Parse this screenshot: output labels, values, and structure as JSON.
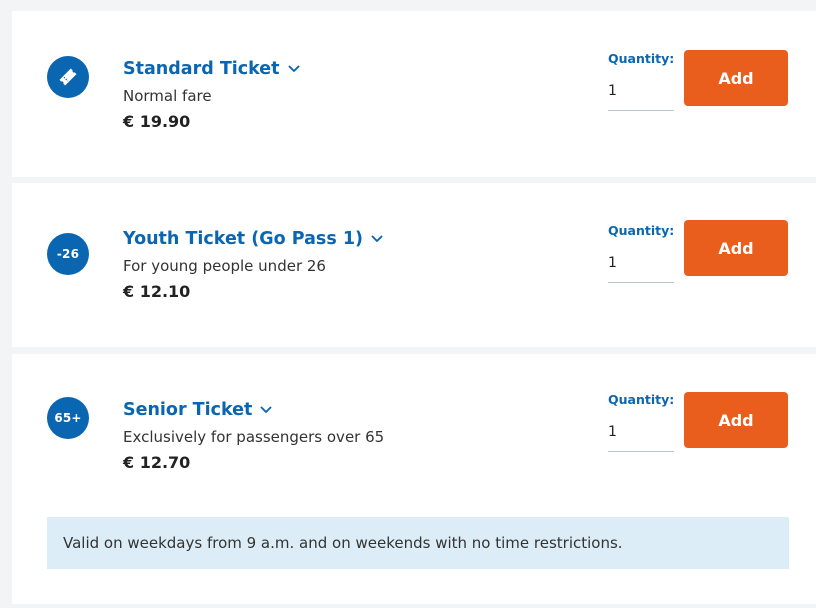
{
  "tickets": [
    {
      "title": "Standard Ticket",
      "description": "Normal fare",
      "price": "€ 19.90",
      "badge": {
        "icon": "ticket-icon",
        "text": ""
      },
      "quantity_label": "Quantity:",
      "quantity_value": "1",
      "add_label": "Add"
    },
    {
      "title": "Youth Ticket (Go Pass 1)",
      "description": "For young people under 26",
      "price": "€ 12.10",
      "badge": {
        "icon": "age-under-26-icon",
        "text": "-26"
      },
      "quantity_label": "Quantity:",
      "quantity_value": "1",
      "add_label": "Add"
    },
    {
      "title": "Senior Ticket",
      "description": "Exclusively for passengers over 65",
      "price": "€ 12.70",
      "badge": {
        "icon": "age-over-65-icon",
        "text": "65+"
      },
      "quantity_label": "Quantity:",
      "quantity_value": "1",
      "add_label": "Add"
    }
  ],
  "senior_notice": "Valid on weekdays from 9 a.m. and on weekends with no time restrictions.",
  "colors": {
    "brand_blue": "#0a66b1",
    "add_button": "#e95e1d",
    "notice_background": "#dcedf7",
    "page_background": "#f2f4f5"
  }
}
